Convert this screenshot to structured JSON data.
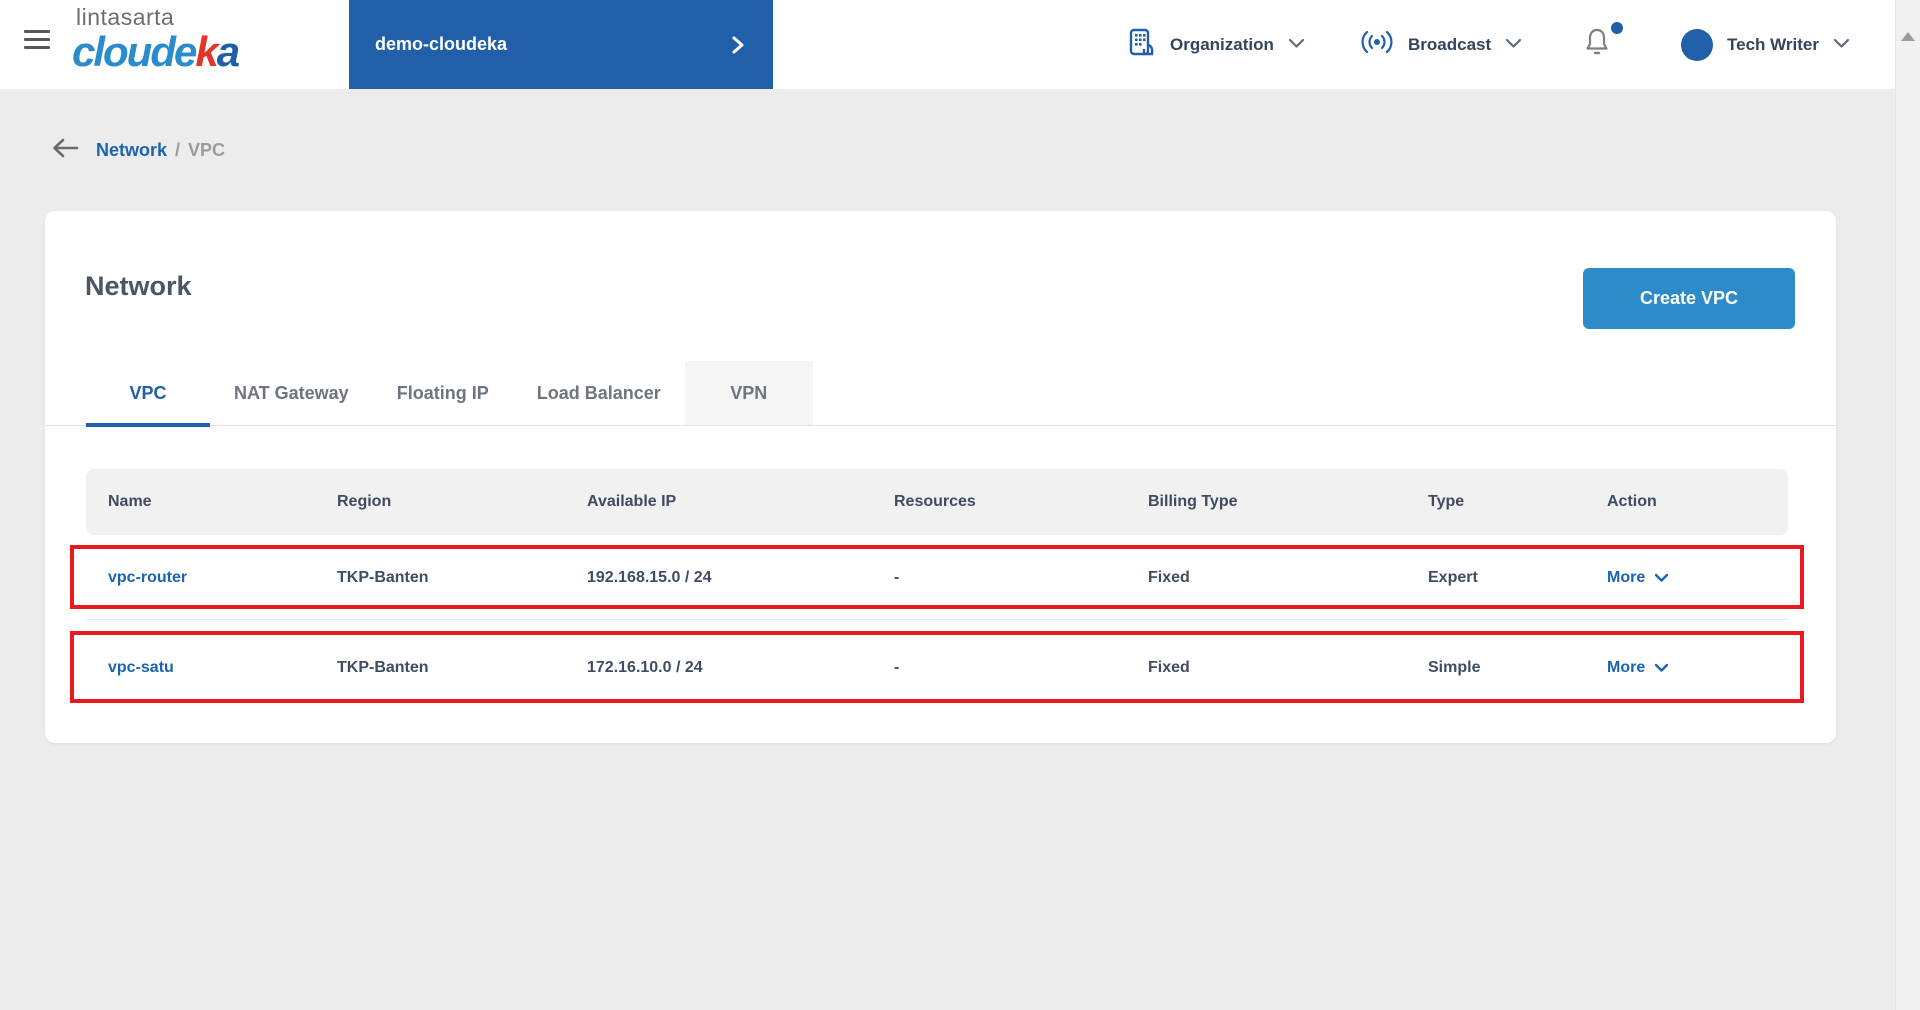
{
  "header": {
    "logo": {
      "top": "lintasarta",
      "brand_pre": "cloude",
      "brand_k": "k",
      "brand_post": "a"
    },
    "project_banner": {
      "label": "demo-cloudeka"
    },
    "organization": {
      "label": "Organization"
    },
    "broadcast": {
      "label": "Broadcast"
    },
    "user": {
      "name": "Tech Writer"
    }
  },
  "breadcrumb": {
    "section": "Network",
    "separator": "/",
    "current": "VPC"
  },
  "page": {
    "title": "Network",
    "create_button_label": "Create VPC",
    "tabs": [
      {
        "label": "VPC",
        "active": true
      },
      {
        "label": "NAT Gateway",
        "active": false
      },
      {
        "label": "Floating IP",
        "active": false
      },
      {
        "label": "Load Balancer",
        "active": false
      },
      {
        "label": "VPN",
        "active": false
      }
    ],
    "table": {
      "columns": [
        "Name",
        "Region",
        "Available IP",
        "Resources",
        "Billing Type",
        "Type",
        "Action"
      ],
      "rows": [
        {
          "name": "vpc-router",
          "region": "TKP-Banten",
          "available_ip": "192.168.15.0 / 24",
          "resources": "-",
          "billing_type": "Fixed",
          "type": "Expert",
          "action_label": "More",
          "highlighted": true
        },
        {
          "name": "vpc-satu",
          "region": "TKP-Banten",
          "available_ip": "172.16.10.0 / 24",
          "resources": "-",
          "billing_type": "Fixed",
          "type": "Simple",
          "action_label": "More",
          "highlighted": true
        }
      ]
    }
  },
  "colors": {
    "banner_blue": "#2160a8",
    "button_blue": "#2e8bca",
    "link_blue": "#1b64b0",
    "highlight_red": "#e8191f",
    "body_background": "#ececec"
  }
}
